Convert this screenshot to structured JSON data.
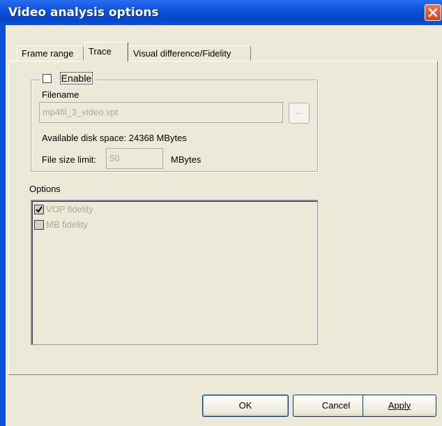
{
  "window": {
    "title": "Video analysis options",
    "close_icon": "close-icon"
  },
  "tabs": [
    {
      "label": "Frame range",
      "active": false
    },
    {
      "label": "Trace",
      "active": true
    },
    {
      "label": "Visual difference/Fidelity",
      "active": false
    }
  ],
  "trace": {
    "enable_label": "Enable",
    "enable_checked": false,
    "filename_label": "Filename",
    "filename_value": "mp4fil_3_video.vpt",
    "browse_label": "...",
    "disk_space_label": "Available disk space: 24368 MBytes",
    "size_limit_label": "File size limit:",
    "size_limit_value": "50",
    "size_limit_unit": "MBytes"
  },
  "options": {
    "label": "Options",
    "items": [
      {
        "label": "VOP fidelity",
        "checked": true
      },
      {
        "label": "MB fidelity",
        "checked": false
      }
    ]
  },
  "buttons": {
    "ok": "OK",
    "cancel": "Cancel",
    "apply": "Apply"
  }
}
